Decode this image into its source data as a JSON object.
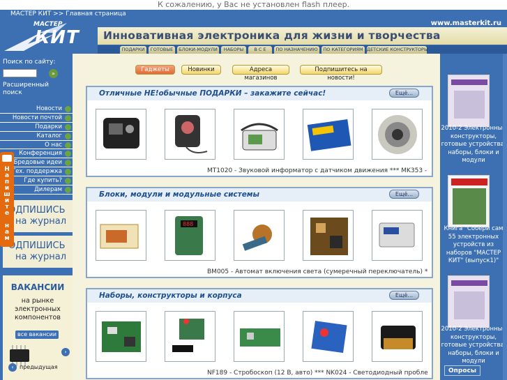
{
  "flash_notice": "К сожалению, у Вас не установлен flash плеер.",
  "breadcrumb": "МАСТЕР КИТ >> Главная страница",
  "logo": {
    "top": "МАСТЕР",
    "main": "КИТ"
  },
  "slogan": "Инновативная электроника для жизни и творчества",
  "site_url": "www.masterkit.ru",
  "nav_tabs": [
    "ПОДАРКИ",
    "ГОТОВЫЕ",
    "БЛОКИ-МОДУЛИ",
    "НАБОРЫ",
    "В С Е",
    "ПО НАЗНАЧЕНИЮ",
    "ПО КАТЕГОРИЯМ",
    "ДЕТСКИЕ КОНСТРУКТОРЫ"
  ],
  "search": {
    "label": "Поиск по сайту:",
    "advanced": "Расширенный поиск",
    "value": ""
  },
  "menu": [
    "Новости",
    "Новости почтой",
    "Подарки",
    "Каталог",
    "О нас",
    "Конференция",
    "Бредовые идеи",
    "Тех. поддержка",
    "Где купить?",
    "Дилерам"
  ],
  "write_us": "Напишите нам",
  "subscribe": {
    "line1": "ОДПИШИСЬ",
    "line2": "на журнал"
  },
  "vacancies": {
    "title": "ВАКАНСИИ",
    "text": "на рынке электронных компонентов",
    "all": "все вакансии",
    "prev": "предыдущая"
  },
  "top_buttons": [
    "Гаджеты",
    "Новинки",
    "Адреса магазинов",
    "Подпишитесь на новости!"
  ],
  "sections": [
    {
      "title": "Отличные НЕ!обычные ПОДАРКИ – закажите сейчас!",
      "more": "Ещё...",
      "caption": "MT1020 - Звуковой информатор с датчиком движения *** MK353 -"
    },
    {
      "title": "Блоки, модули и модульные системы",
      "more": "Ещё...",
      "caption": "BM005 - Автомат включения света (сумеречный переключатель) *"
    },
    {
      "title": "Наборы, конструкторы и корпуса",
      "more": "Ещё...",
      "caption": "NF189 - Стробоскоп (12 В, авто) *** NK024 - Светодиодный пробле"
    }
  ],
  "right_books": [
    {
      "text": "2010-2 Электронные конструкторы, готовые устройства, наборы, блоки и модули"
    },
    {
      "text": "Книга \"Собери сам 55 электронных устройств из наборов \"МАСТЕР КИТ\" (выпуск1)\""
    },
    {
      "text": "2010-2 Электронные конструкторы, готовые устройства, наборы, блоки и модули"
    }
  ],
  "polls": "Опросы",
  "colors": {
    "blue": "#3d6fb3",
    "cream": "#f5f2dd",
    "orange": "#e46a10",
    "green": "#6aa543"
  }
}
